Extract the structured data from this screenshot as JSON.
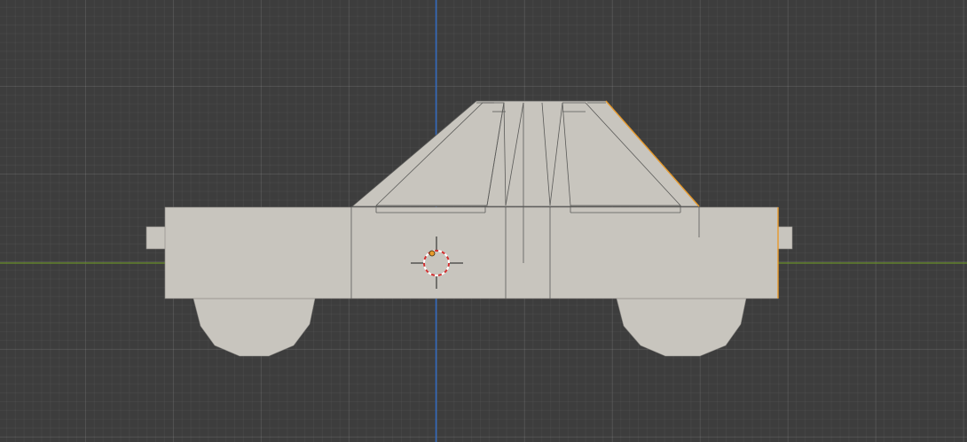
{
  "viewport": {
    "background_color": "#3d3d3d",
    "x_axis_color": "#6a8f28",
    "z_axis_color": "#2f68c0",
    "mesh_fill_color": "#c8c5be",
    "mesh_edge_color": "#5a5a58",
    "selection_outline_color": "#e79a2c",
    "origin_marker_color": "#e79a2c",
    "cursor_ring_colors": [
      "#d03030",
      "#ffffff"
    ]
  },
  "scene_object": {
    "description_icon": "car-mesh"
  },
  "cursor": {
    "icon": "3d-cursor-icon"
  }
}
